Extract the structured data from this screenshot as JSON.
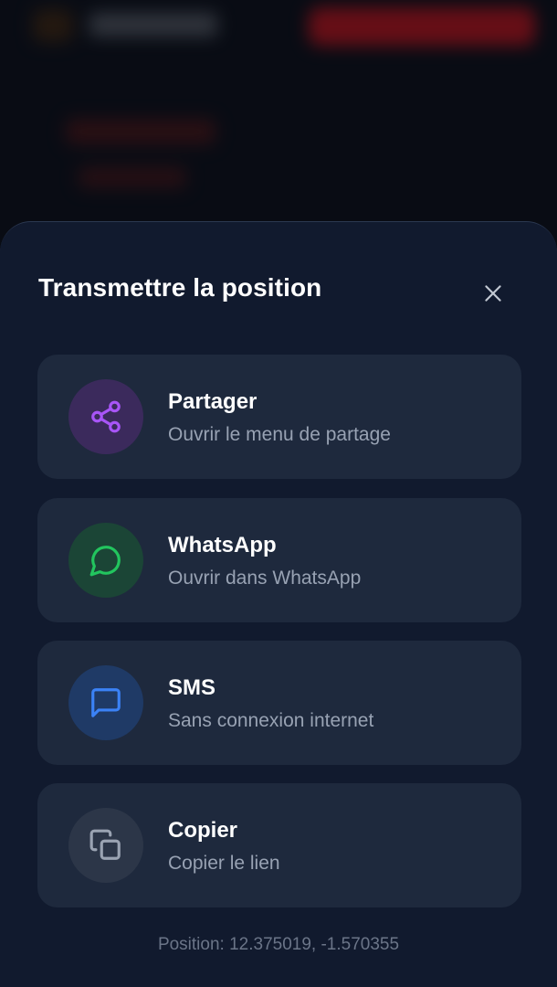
{
  "sheet": {
    "title": "Transmettre la position",
    "close_icon": "close-icon"
  },
  "options": [
    {
      "title": "Partager",
      "subtitle": "Ouvrir le menu de partage",
      "icon": "share-icon",
      "color": "#a855f7",
      "bg": "#3b2a5c"
    },
    {
      "title": "WhatsApp",
      "subtitle": "Ouvrir dans WhatsApp",
      "icon": "whatsapp-icon",
      "color": "#22c55e",
      "bg": "#1b4536"
    },
    {
      "title": "SMS",
      "subtitle": "Sans connexion internet",
      "icon": "message-icon",
      "color": "#3b82f6",
      "bg": "#1f3a66"
    },
    {
      "title": "Copier",
      "subtitle": "Copier le lien",
      "icon": "copy-icon",
      "color": "#9aa3b2",
      "bg": "#2c3648"
    }
  ],
  "footer": {
    "position": "Position: 12.375019, -1.570355"
  },
  "colors": {
    "sheet_bg": "#111a2e",
    "card_bg": "#1e293d",
    "accent_red": "#b3121b"
  }
}
